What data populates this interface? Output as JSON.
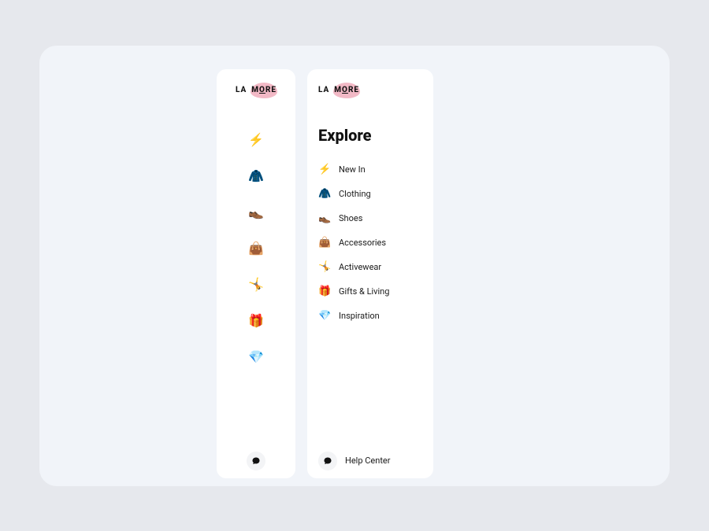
{
  "logo": {
    "la": "LA",
    "more_m": "M",
    "more_o": "O",
    "more_re": "RE"
  },
  "heading": "Explore",
  "items": [
    {
      "emoji": "⚡",
      "label": "New In",
      "name": "new-in"
    },
    {
      "emoji": "🧥",
      "label": "Clothing",
      "name": "clothing"
    },
    {
      "emoji": "👞",
      "label": "Shoes",
      "name": "shoes"
    },
    {
      "emoji": "👜",
      "label": "Accessories",
      "name": "accessories"
    },
    {
      "emoji": "🤸",
      "label": "Activewear",
      "name": "activewear"
    },
    {
      "emoji": "🎁",
      "label": "Gifts & Living",
      "name": "gifts-living"
    },
    {
      "emoji": "💎",
      "label": "Inspiration",
      "name": "inspiration"
    }
  ],
  "help": {
    "label": "Help Center"
  }
}
